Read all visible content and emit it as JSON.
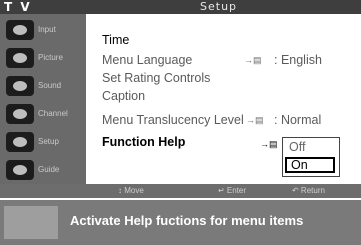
{
  "header": {
    "app_label": "T V",
    "menu_title": "Setup"
  },
  "sidebar": {
    "items": [
      {
        "icon": "input-icon",
        "label": "Input"
      },
      {
        "icon": "picture-icon",
        "label": "Picture"
      },
      {
        "icon": "sound-icon",
        "label": "Sound"
      },
      {
        "icon": "channel-icon",
        "label": "Channel"
      },
      {
        "icon": "setup-icon",
        "label": "Setup"
      },
      {
        "icon": "guide-icon",
        "label": "Guide"
      }
    ]
  },
  "menu": {
    "time": "Time",
    "menu_language": "Menu Language",
    "menu_language_value": ": English",
    "set_rating": "Set Rating Controls",
    "caption": "Caption",
    "translucency": "Menu Translucency Level",
    "translucency_value": ": Normal",
    "function_help": "Function Help",
    "enter_glyph": "→▤"
  },
  "dropdown": {
    "options": [
      "Off",
      "On"
    ],
    "selected": "On"
  },
  "navbar": {
    "move": "↕ Move",
    "enter": "↵ Enter",
    "return": "↶ Return"
  },
  "help": {
    "text": "Activate Help fuctions for menu items"
  }
}
